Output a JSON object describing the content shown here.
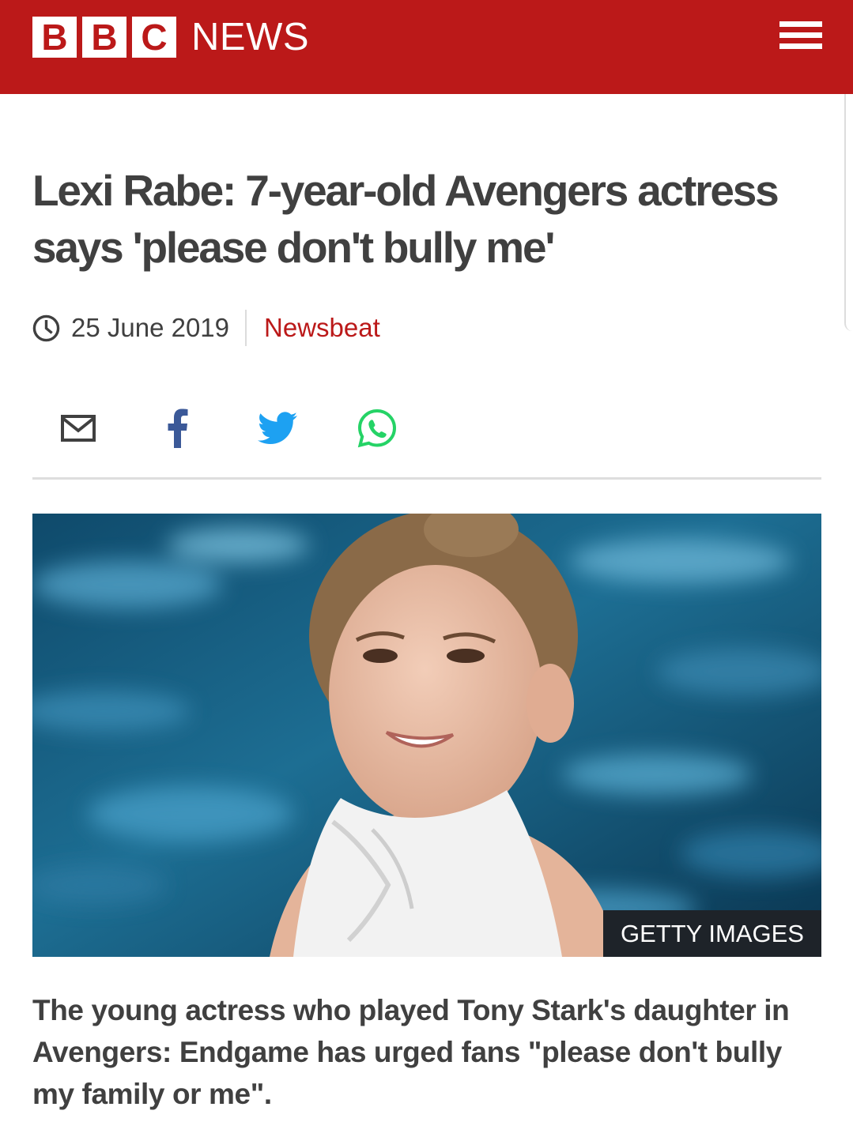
{
  "header": {
    "logo_letters": [
      "B",
      "B",
      "C"
    ],
    "logo_word": "NEWS",
    "menu_icon": "hamburger-menu-icon",
    "background_color": "#bb1919"
  },
  "article": {
    "headline": "Lexi Rabe: 7-year-old Avengers actress says 'please don't bully me'",
    "date": "25 June 2019",
    "section": "Newsbeat",
    "share_buttons": [
      {
        "name": "email",
        "icon": "envelope-icon"
      },
      {
        "name": "facebook",
        "icon": "facebook-icon",
        "color": "#3b5998"
      },
      {
        "name": "twitter",
        "icon": "twitter-icon",
        "color": "#1da1f2"
      },
      {
        "name": "whatsapp",
        "icon": "whatsapp-icon",
        "color": "#25d366"
      }
    ],
    "image_credit": "GETTY IMAGES",
    "intro": "The young actress who played Tony Stark's daughter in Avengers: Endgame has urged fans \"please don't bully my family or me\"."
  }
}
